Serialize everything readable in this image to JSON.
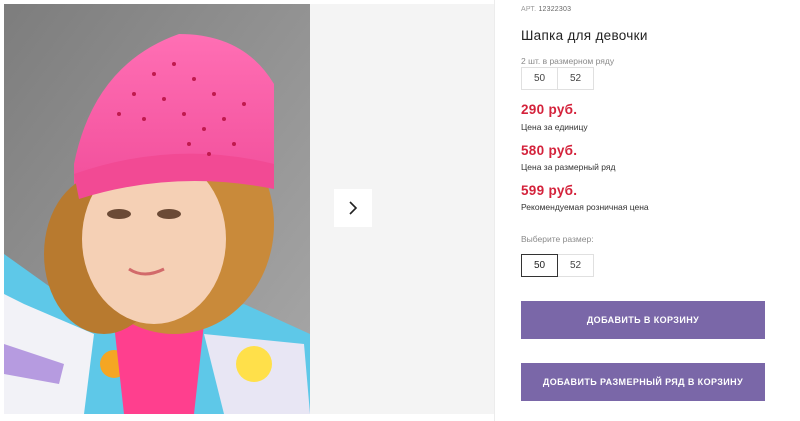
{
  "product": {
    "article_prefix": "АРТ.",
    "article_number": "12322303",
    "title": "Шапка для девочки",
    "pack_label": "2 шт. в размерном ряду",
    "pack_sizes": [
      "50",
      "52"
    ],
    "prices": [
      {
        "value": "290 руб.",
        "caption": "Цена за единицу"
      },
      {
        "value": "580 руб.",
        "caption": "Цена за размерный ряд"
      },
      {
        "value": "599 руб.",
        "caption": "Рекомендуемая розничная цена"
      }
    ],
    "choose_size_label": "Выберите размер:",
    "size_options": [
      "50",
      "52"
    ],
    "selected_size": "50"
  },
  "actions": {
    "add_to_cart": "ДОБАВИТЬ В КОРЗИНУ",
    "add_row_to_cart": "ДОБАВИТЬ РАЗМЕРНЫЙ РЯД В КОРЗИНУ"
  },
  "colors": {
    "price": "#d4223b",
    "button": "#7a67a8"
  },
  "icons": {
    "gallery_next": "chevron-right-icon"
  }
}
